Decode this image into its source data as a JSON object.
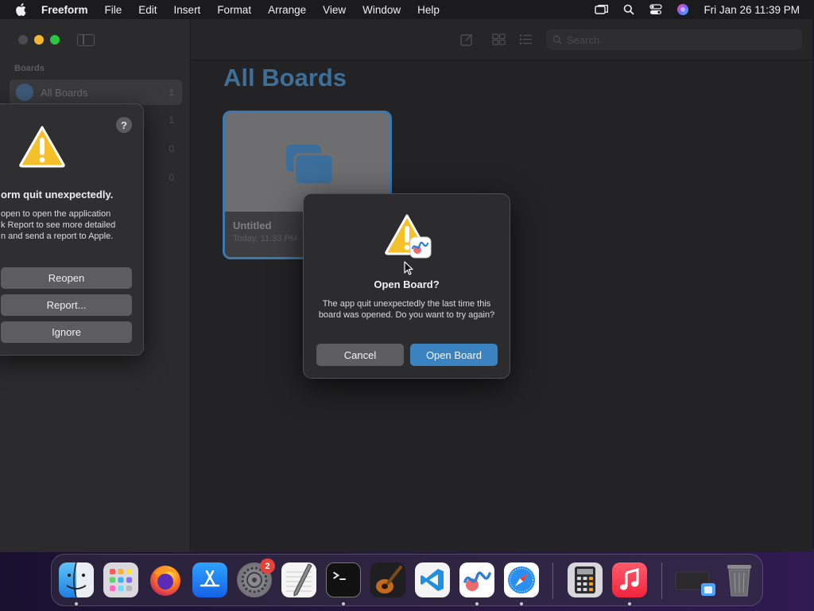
{
  "menubar": {
    "apple_icon": "apple-logo-icon",
    "items": [
      "Freeform",
      "File",
      "Edit",
      "Insert",
      "Format",
      "Arrange",
      "View",
      "Window",
      "Help"
    ],
    "status_icons": [
      "screen-mirroring-icon",
      "spotlight-search-icon",
      "control-center-icon",
      "siri-icon"
    ],
    "clock": "Fri Jan 26  11:39 PM"
  },
  "window": {
    "sidebar": {
      "section_label": "Boards",
      "items": [
        {
          "label": "All Boards",
          "count": "1"
        }
      ],
      "extra_counts": [
        "1",
        "0",
        "0"
      ]
    },
    "toolbar": {
      "search_placeholder": "Search",
      "icons": [
        "new-board-icon",
        "grid-view-icon",
        "list-view-icon",
        "search-icon"
      ]
    },
    "page_title": "All Boards",
    "board": {
      "name": "Untitled",
      "date": "Today, 11:33 PM"
    }
  },
  "crash_dialog": {
    "title": "orm quit unexpectedly.",
    "body_lines": [
      "open to open the application",
      "k Report to see more detailed",
      "n and send a report to Apple."
    ],
    "buttons": {
      "reopen": "Reopen",
      "report": "Report...",
      "ignore": "Ignore"
    },
    "help_label": "?"
  },
  "open_board_dialog": {
    "title": "Open Board?",
    "body": "The app quit unexpectedly the last time this board was opened. Do you want to try again?",
    "buttons": {
      "cancel": "Cancel",
      "open": "Open Board"
    }
  },
  "dock": {
    "apps": [
      "Finder",
      "Launchpad",
      "Firefox",
      "App Store",
      "System Settings",
      "TextEdit",
      "Terminal",
      "GarageBand",
      "Visual Studio Code",
      "Freeform",
      "Safari",
      "Calculator",
      "Music",
      "Downloads",
      "Trash"
    ],
    "settings_badge": "2"
  },
  "colors": {
    "accent": "#3b83c0",
    "title_blue": "#3e6f98",
    "warning_yellow": "#f5c02a"
  }
}
